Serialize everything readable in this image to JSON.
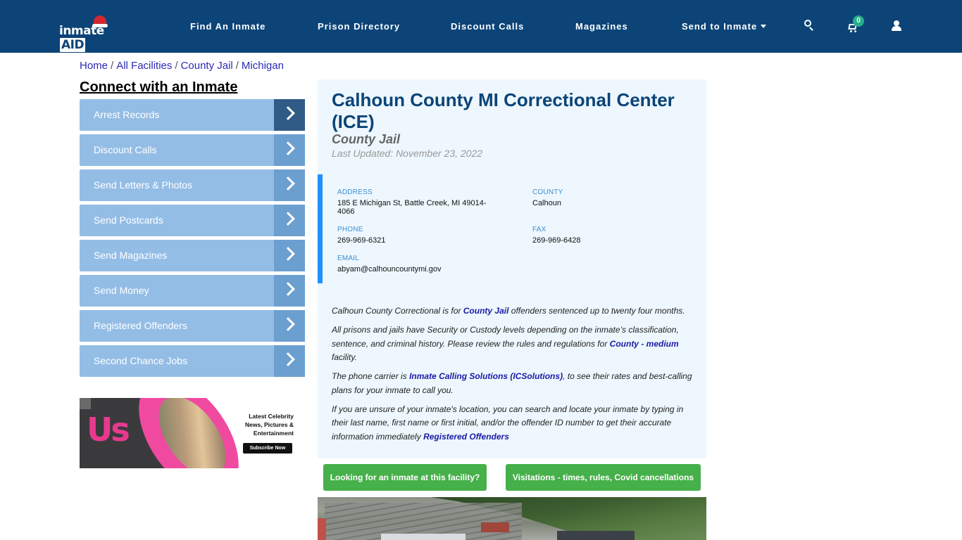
{
  "header": {
    "logo_text": "inmate",
    "logo_accent": "AID",
    "nav": [
      {
        "label": "Find An Inmate"
      },
      {
        "label": "Prison Directory"
      },
      {
        "label": "Discount Calls"
      },
      {
        "label": "Magazines"
      },
      {
        "label": "Send to Inmate",
        "has_dropdown": true
      }
    ],
    "icons": {
      "search": "search-icon",
      "cart": "cart-icon",
      "account": "user-icon"
    },
    "cart_count": "0",
    "colors": {
      "bar": "#0c4478",
      "badge": "#26b08a"
    }
  },
  "breadcrumb": [
    {
      "label": "Home"
    },
    {
      "label": "All Facilities"
    },
    {
      "label": "County Jail"
    },
    {
      "label": "Michigan"
    }
  ],
  "sidebar": {
    "title": "Connect with an Inmate",
    "items": [
      {
        "label": "Arrest Records",
        "active": true
      },
      {
        "label": "Discount Calls"
      },
      {
        "label": "Send Letters & Photos"
      },
      {
        "label": "Send Postcards"
      },
      {
        "label": "Send Magazines"
      },
      {
        "label": "Send Money"
      },
      {
        "label": "Registered Offenders"
      },
      {
        "label": "Second Chance Jobs"
      }
    ],
    "ad": {
      "brand": "Us",
      "headline_1": "Latest Celebrity",
      "headline_2": "News, Pictures &",
      "headline_3": "Entertainment",
      "cta": "Subscribe Now"
    }
  },
  "facility": {
    "name": "Calhoun County MI Correctional Center (ICE)",
    "type": "County Jail",
    "last_updated": "Last Updated: November 23, 2022",
    "fields": {
      "address_label": "ADDRESS",
      "address_line1": "185 E Michigan St, Battle Creek, MI 49014-",
      "address_line2": "4066",
      "county_label": "COUNTY",
      "county": "Calhoun",
      "phone_label": "PHONE",
      "phone": "269-969-6321",
      "fax_label": "FAX",
      "fax": "269-969-6428",
      "email_label": "EMAIL",
      "email": "abyam@calhouncountymi.gov"
    },
    "description": {
      "p1_a": "Calhoun County Correctional is for ",
      "p1_link": "County Jail",
      "p1_b": " offenders sentenced up to twenty four months.",
      "p2_a": "All prisons and jails have Security or Custody levels depending on the inmate’s classification, sentence, and criminal history. Please review the rules and regulations for ",
      "p2_link": "County - medium",
      "p2_b": " facility.",
      "p3_a": "The phone carrier is ",
      "p3_link": "Inmate Calling Solutions (ICSolutions)",
      "p3_b": ", to see their rates and best-calling plans for your inmate to call you.",
      "p4_a": "If you are unsure of your inmate's location, you can search and locate your inmate by typing in their last name, first name or first initial, and/or the offender ID number to get their accurate information immediately ",
      "p4_link": "Registered Offenders"
    }
  },
  "actions": {
    "find_inmate": "Looking for an inmate at this facility?",
    "visitation": "Visitations - times, rules, Covid cancellations"
  }
}
